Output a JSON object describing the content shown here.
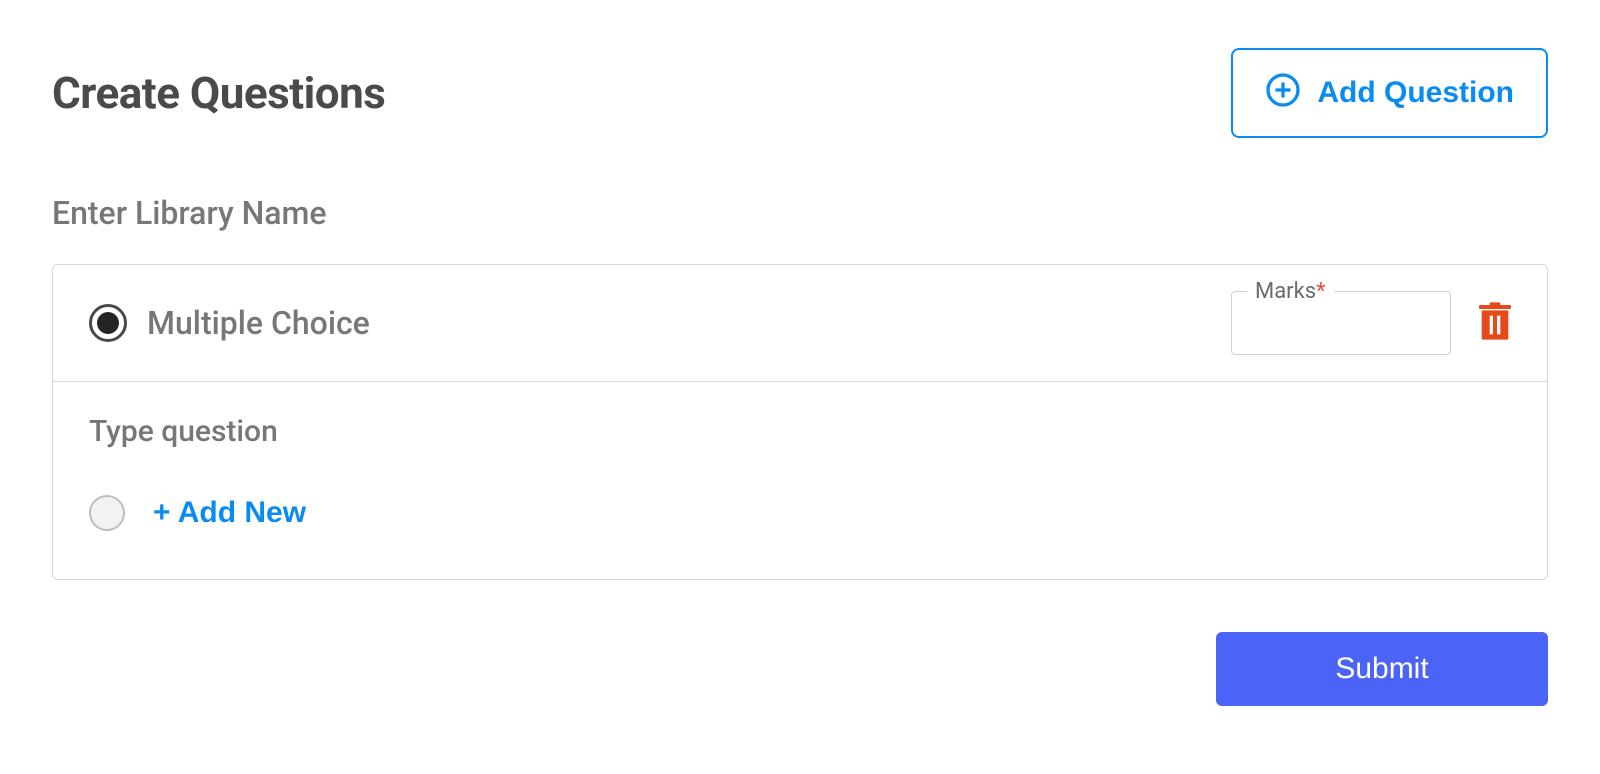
{
  "header": {
    "title": "Create Questions",
    "add_question_label": "Add Question"
  },
  "library": {
    "placeholder_label": "Enter Library Name"
  },
  "question": {
    "type_label": "Multiple Choice",
    "marks_label": "Marks",
    "marks_value": "",
    "body_placeholder": "Type question",
    "add_new_label": "+ Add New"
  },
  "footer": {
    "submit_label": "Submit"
  },
  "colors": {
    "primary_blue": "#0a8bf2",
    "submit_blue": "#4c63f7",
    "danger": "#e74c3c"
  }
}
